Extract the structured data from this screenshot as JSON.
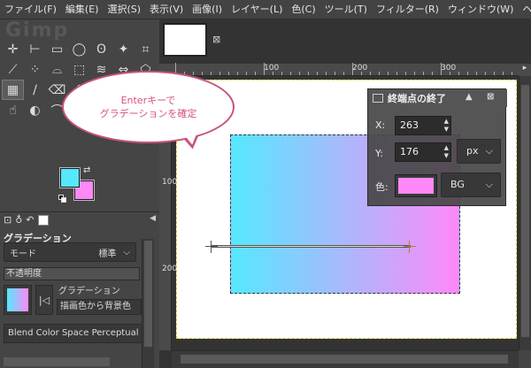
{
  "menubar": {
    "items": [
      {
        "label": "ファイル(F)"
      },
      {
        "label": "編集(E)"
      },
      {
        "label": "選択(S)"
      },
      {
        "label": "表示(V)"
      },
      {
        "label": "画像(I)"
      },
      {
        "label": "レイヤー(L)"
      },
      {
        "label": "色(C)"
      },
      {
        "label": "ツール(T)"
      },
      {
        "label": "フィルター(R)"
      },
      {
        "label": "ウィンドウ(W)"
      },
      {
        "label": "ヘルプ(H)"
      }
    ]
  },
  "toolbox": {
    "watermark": "Gimp",
    "tools": [
      {
        "icon": "move-icon",
        "glyph": "✛"
      },
      {
        "icon": "align-icon",
        "glyph": "⊢"
      },
      {
        "icon": "rect-select-icon",
        "glyph": "▭"
      },
      {
        "icon": "ellipse-select-icon",
        "glyph": "◯"
      },
      {
        "icon": "lasso-icon",
        "glyph": "ʘ"
      },
      {
        "icon": "fuzzy-select-icon",
        "glyph": "✦"
      },
      {
        "icon": "crop-icon",
        "glyph": "⌗"
      },
      {
        "icon": "wand-icon",
        "glyph": "⟋"
      },
      {
        "icon": "select-by-color-icon",
        "glyph": "⁘"
      },
      {
        "icon": "scissors-select-icon",
        "glyph": "⌓"
      },
      {
        "icon": "transform-icon",
        "glyph": "⬚"
      },
      {
        "icon": "warp-icon",
        "glyph": "≋"
      },
      {
        "icon": "flip-icon",
        "glyph": "⇔"
      },
      {
        "icon": "perspective-icon",
        "glyph": "⬠"
      },
      {
        "icon": "gradient-icon",
        "glyph": "▦",
        "active": true
      },
      {
        "icon": "brush-icon",
        "glyph": "∕"
      },
      {
        "icon": "eraser-icon",
        "glyph": "⌫"
      },
      {
        "icon": "airbrush-icon",
        "glyph": "⟰"
      },
      {
        "icon": "ink-icon",
        "glyph": "✒"
      },
      {
        "icon": "clone-icon",
        "glyph": "⎘"
      },
      {
        "icon": "heal-icon",
        "glyph": "✚"
      },
      {
        "icon": "smudge-icon",
        "glyph": "☝"
      },
      {
        "icon": "dodge-icon",
        "glyph": "◐"
      },
      {
        "icon": "path-icon",
        "glyph": "⌒"
      },
      {
        "icon": "text-icon",
        "glyph": "A"
      },
      {
        "icon": "color-picker-icon",
        "glyph": "⟆"
      },
      {
        "icon": "zoom-icon",
        "glyph": "⌕"
      },
      {
        "icon": "measure-icon",
        "glyph": "⊿"
      }
    ],
    "fg_color": "#55e8ff",
    "bg_color": "#ff88f8"
  },
  "tool_options": {
    "title": "グラデーション",
    "mode_label": "モード",
    "mode_value": "標準",
    "opacity_label": "不透明度",
    "gradient_label": "グラデーション",
    "gradient_name": "描画色から背景色",
    "blend_space": "Blend Color Space Perceptual R"
  },
  "canvas": {
    "ruler_top_labels": [
      {
        "label": "100"
      },
      {
        "label": "200"
      },
      {
        "label": "300"
      }
    ],
    "ruler_left_labels": [
      {
        "label": "100"
      },
      {
        "label": "200"
      }
    ],
    "gradient_start": "#55e8ff",
    "gradient_end": "#ff88f8"
  },
  "dialog": {
    "title": "終端点の終了",
    "x_label": "X:",
    "x_value": "263",
    "y_label": "Y:",
    "y_value": "176",
    "unit": "px",
    "color_label": "色:",
    "color_value": "#ff88f8",
    "color_mode": "BG"
  },
  "callout": {
    "line1": "Enterキーで",
    "line2": "グラデーションを確定"
  }
}
